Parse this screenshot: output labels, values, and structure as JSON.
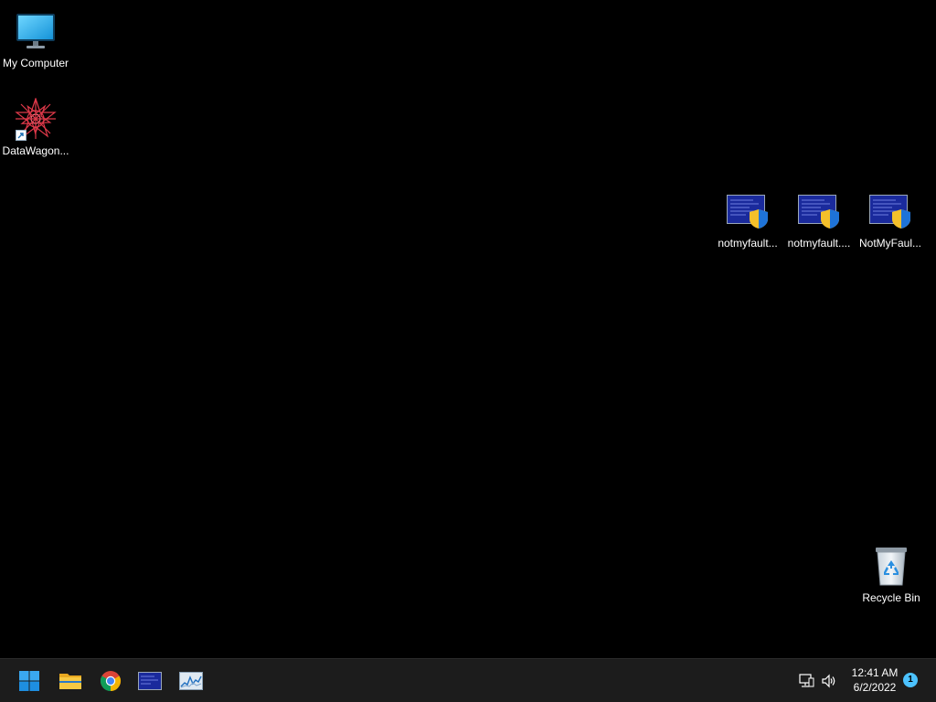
{
  "desktop": {
    "background": "#000000",
    "icons": {
      "my_computer": {
        "label": "My Computer",
        "icon": "monitor-icon"
      },
      "datawagon": {
        "label": "DataWagon...",
        "icon": "datawagon-logo-icon"
      },
      "notmyfault1": {
        "label": "notmyfault...",
        "icon": "bsod-uac-shield-icon"
      },
      "notmyfault2": {
        "label": "notmyfault....",
        "icon": "bsod-uac-shield-icon"
      },
      "notmyfault3": {
        "label": "NotMyFaul...",
        "icon": "bsod-uac-shield-icon"
      },
      "recycle_bin": {
        "label": "Recycle Bin",
        "icon": "recycle-bin-icon"
      }
    }
  },
  "taskbar": {
    "background": "#1c1c1c",
    "pinned": [
      "start-icon",
      "file-explorer-icon",
      "chrome-icon",
      "bsod-app-icon",
      "performance-monitor-icon"
    ],
    "tray": {
      "network_icon": "network-icon",
      "volume_icon": "volume-icon",
      "time": "12:41 AM",
      "date": "6/2/2022",
      "notification_count": "1"
    }
  },
  "colors": {
    "accent": "#4cc2ff",
    "windows_blue": "#0078d4"
  }
}
